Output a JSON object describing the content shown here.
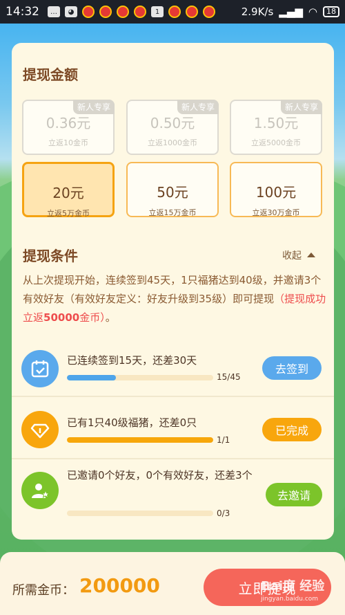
{
  "status_bar": {
    "time": "14:32",
    "notif_badge": "1",
    "net_speed": "2.9K/s",
    "battery": "18"
  },
  "withdraw_amount": {
    "title": "提现金额",
    "options": [
      {
        "amount": "0.36元",
        "note": "立返10金币",
        "badge": "新人专享",
        "state": "disabled"
      },
      {
        "amount": "0.50元",
        "note": "立返1000金币",
        "badge": "新人专享",
        "state": "disabled"
      },
      {
        "amount": "1.50元",
        "note": "立返5000金币",
        "badge": "新人专享",
        "state": "disabled"
      },
      {
        "amount": "20元",
        "note": "立返5万金币",
        "badge": "",
        "state": "selected"
      },
      {
        "amount": "50元",
        "note": "立返15万金币",
        "badge": "",
        "state": "available"
      },
      {
        "amount": "100元",
        "note": "立返30万金币",
        "badge": "",
        "state": "available"
      }
    ]
  },
  "conditions": {
    "title": "提现条件",
    "collapse_label": "收起",
    "desc_main": "从上次提现开始，连续签到45天，1只福猪达到40级，并邀请3个有效好友（有效好友定义：好友升级到35级）即可提现",
    "desc_red_pre": "（提现成功立返",
    "desc_red_bold": "50000",
    "desc_red_post": "金币）",
    "desc_end": "。",
    "tasks": [
      {
        "text": "已连续签到15天，还差30天",
        "progress_text": "15/45",
        "progress": 0.333,
        "button": "去签到",
        "icon": "calendar-icon",
        "color": "#5aa9ec"
      },
      {
        "text": "已有1只40级福猪，还差0只",
        "progress_text": "1/1",
        "progress": 1.0,
        "button": "已完成",
        "icon": "diamond-icon",
        "color": "#f8a60d"
      },
      {
        "text": "已邀请0个好友，0个有效好友，还差3个",
        "progress_text": "0/3",
        "progress": 0.0,
        "button": "去邀请",
        "icon": "user-star-icon",
        "color": "#7cc42a"
      }
    ]
  },
  "footer": {
    "required_label": "所需金币：",
    "required_value": "200000",
    "withdraw_button": "立即提现"
  },
  "watermark": {
    "brand": "Bai度 经验",
    "url": "jingyan.baidu.com"
  }
}
